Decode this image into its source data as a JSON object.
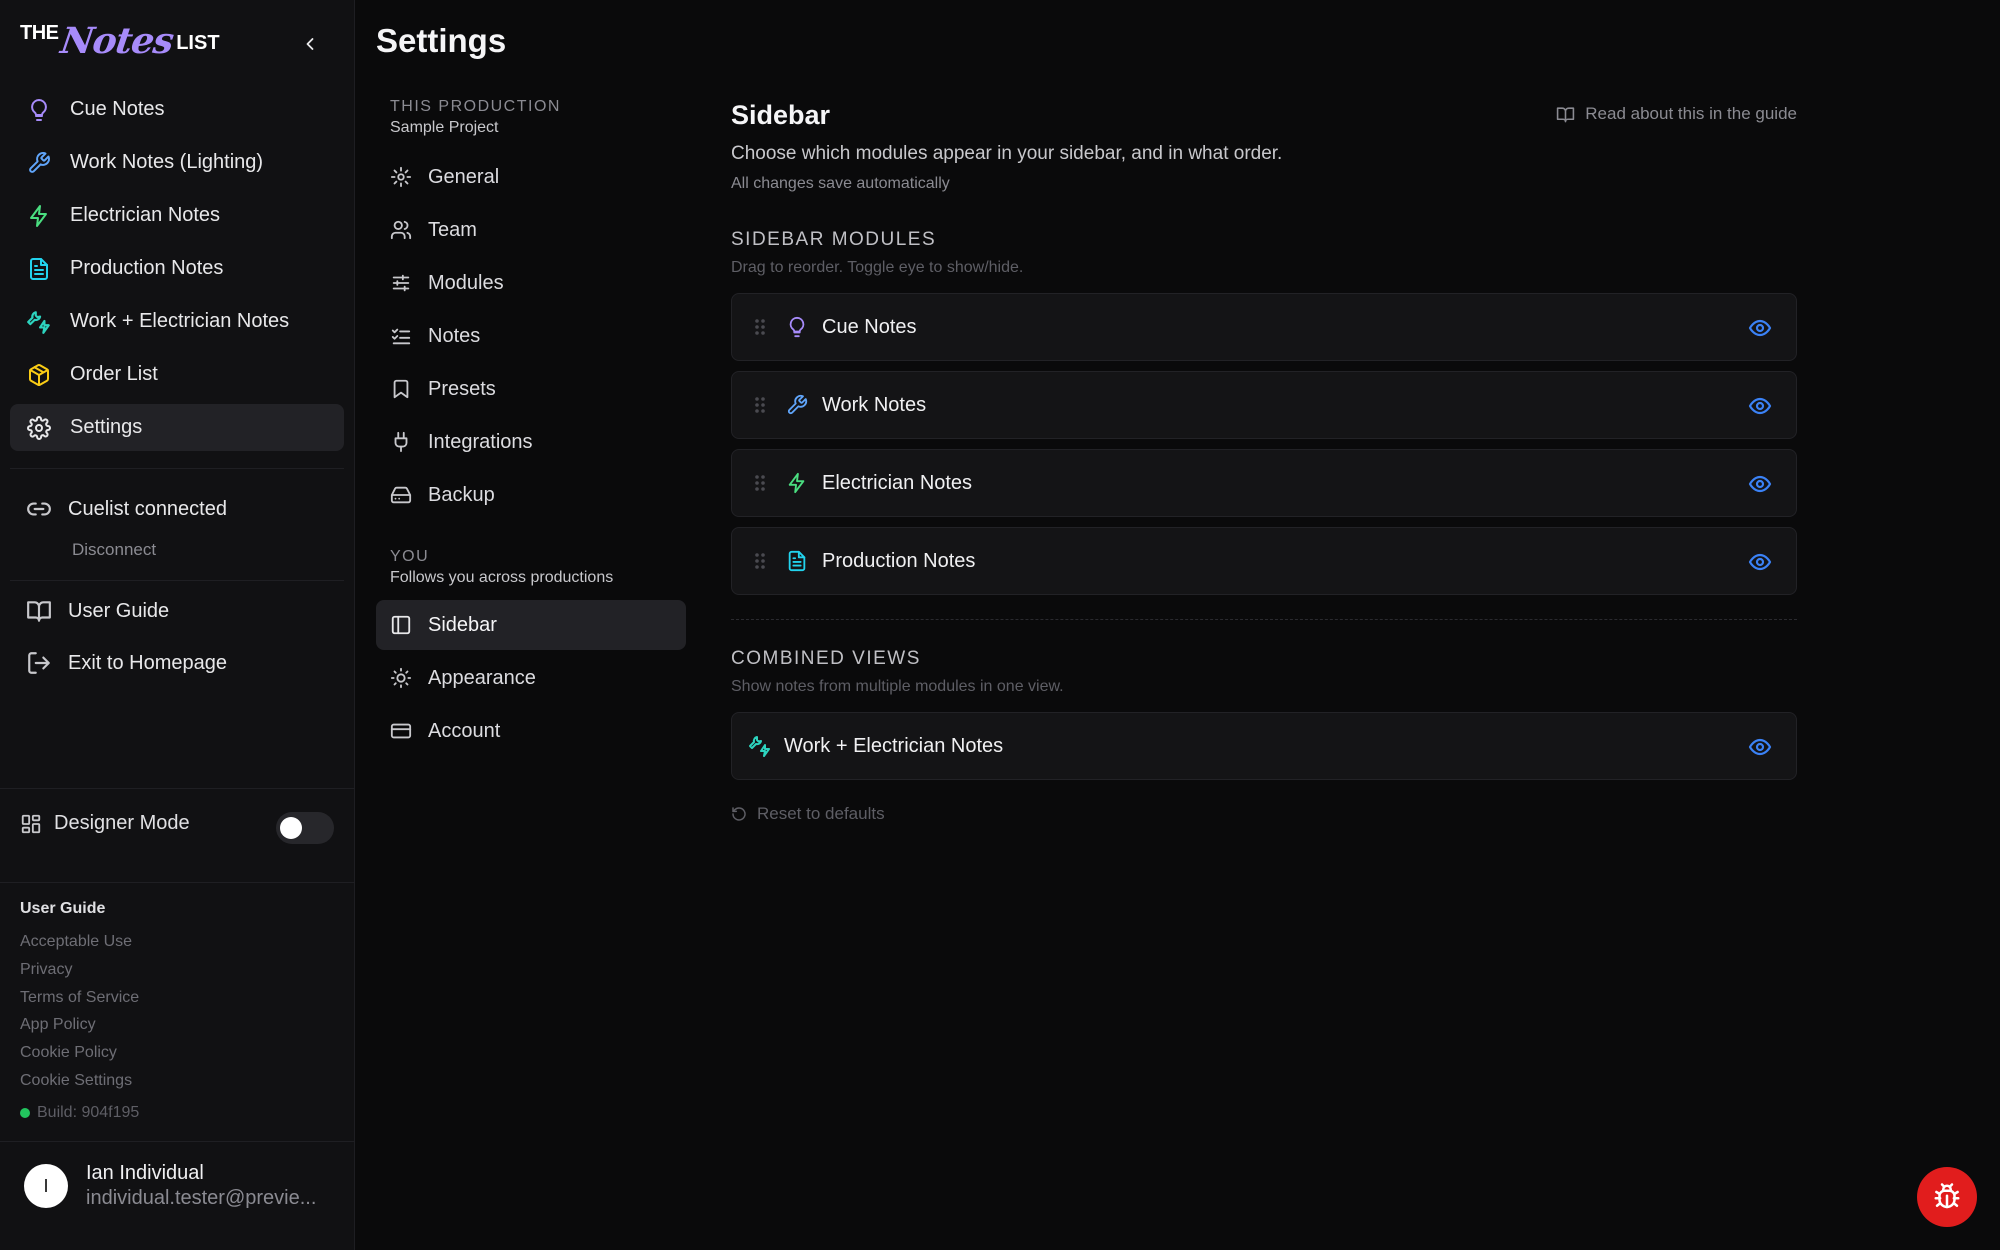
{
  "logo": {
    "the": "THE",
    "notes": "Notes",
    "list": "LIST"
  },
  "sidebar": {
    "items": [
      {
        "label": "Cue Notes",
        "icon": "lightbulb-icon",
        "color": "#a78bfa"
      },
      {
        "label": "Work Notes (Lighting)",
        "icon": "wrench-icon",
        "color": "#60a5fa"
      },
      {
        "label": "Electrician Notes",
        "icon": "zap-icon",
        "color": "#4ade80"
      },
      {
        "label": "Production Notes",
        "icon": "file-text-icon",
        "color": "#22d3ee"
      },
      {
        "label": "Work + Electrician Notes",
        "icon": "wrench-zap-icon",
        "color": "#2dd4bf"
      },
      {
        "label": "Order List",
        "icon": "package-icon",
        "color": "#facc15"
      },
      {
        "label": "Settings",
        "icon": "gear-icon",
        "color": "#e8e8ea",
        "active": true
      }
    ],
    "cuelist": {
      "label": "Cuelist connected",
      "action": "Disconnect"
    },
    "user_guide": "User Guide",
    "exit": "Exit to Homepage",
    "designer_mode": {
      "label": "Designer Mode",
      "enabled": false
    },
    "footer": {
      "heading": "User Guide",
      "links": [
        "Acceptable Use",
        "Privacy",
        "Terms of Service",
        "App Policy",
        "Cookie Policy",
        "Cookie Settings"
      ],
      "build": "Build: 904f195"
    },
    "user": {
      "initial": "I",
      "name": "Ian Individual",
      "email": "individual.tester@previe..."
    }
  },
  "page": {
    "title": "Settings"
  },
  "settings_nav": {
    "production": {
      "heading": "THIS PRODUCTION",
      "subtitle": "Sample Project",
      "items": [
        {
          "label": "General",
          "icon": "gear-icon"
        },
        {
          "label": "Team",
          "icon": "users-icon"
        },
        {
          "label": "Modules",
          "icon": "sliders-icon"
        },
        {
          "label": "Notes",
          "icon": "list-checks-icon"
        },
        {
          "label": "Presets",
          "icon": "bookmark-icon"
        },
        {
          "label": "Integrations",
          "icon": "plug-icon"
        },
        {
          "label": "Backup",
          "icon": "hard-drive-icon"
        }
      ]
    },
    "you": {
      "heading": "YOU",
      "subtitle": "Follows you across productions",
      "items": [
        {
          "label": "Sidebar",
          "icon": "panel-left-icon",
          "active": true
        },
        {
          "label": "Appearance",
          "icon": "sun-icon"
        },
        {
          "label": "Account",
          "icon": "credit-card-icon"
        }
      ]
    }
  },
  "main": {
    "title": "Sidebar",
    "description": "Choose which modules appear in your sidebar, and in what order.",
    "autosave": "All changes save automatically",
    "guide_link": "Read about this in the guide",
    "modules_section": {
      "heading": "SIDEBAR MODULES",
      "hint": "Drag to reorder. Toggle eye to show/hide.",
      "items": [
        {
          "label": "Cue Notes",
          "icon": "lightbulb-icon",
          "color": "#a78bfa",
          "visible": true
        },
        {
          "label": "Work Notes",
          "icon": "wrench-icon",
          "color": "#60a5fa",
          "visible": true
        },
        {
          "label": "Electrician Notes",
          "icon": "zap-icon",
          "color": "#4ade80",
          "visible": true
        },
        {
          "label": "Production Notes",
          "icon": "file-text-icon",
          "color": "#22d3ee",
          "visible": true
        }
      ]
    },
    "combined_section": {
      "heading": "COMBINED VIEWS",
      "hint": "Show notes from multiple modules in one view.",
      "items": [
        {
          "label": "Work + Electrician Notes",
          "icon": "wrench-zap-icon",
          "color": "#2dd4bf",
          "visible": true
        }
      ]
    },
    "reset": "Reset to defaults"
  },
  "colors": {
    "accent_eye": "#3b82f6",
    "bug_button": "#e11d1d",
    "status_ok": "#22c55e"
  }
}
